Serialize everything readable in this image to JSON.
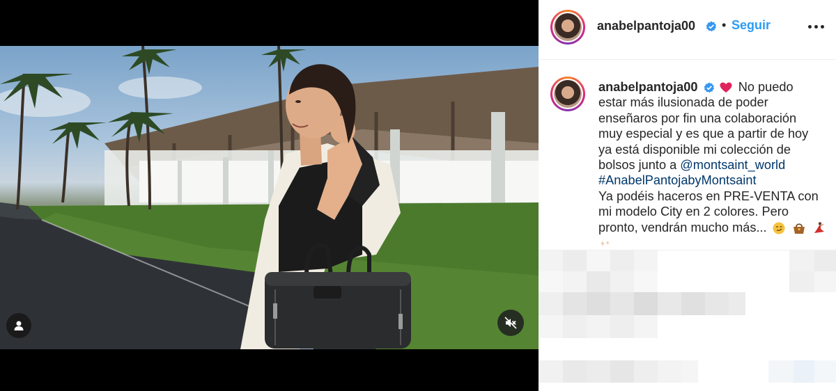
{
  "post": {
    "username": "anabelpantoja00",
    "verified": true,
    "separator": "•",
    "follow_label": "Seguir",
    "more_icon": "more-horizontal-icon"
  },
  "caption": {
    "username": "anabelpantoja00",
    "lines": [
      "No puedo",
      "estar más ilusionada de poder",
      "enseñaros por fin una colaboración",
      "muy especial y es que a partir de hoy",
      "ya está disponible mi colección de",
      "bolsos junto a",
      "Ya podéis haceros en PRE-VENTA con",
      "mi modelo City en 2 colores. Pero",
      "pronto, vendrán mucho más..."
    ],
    "mention": "@montsaint_world",
    "hashtag": "#AnabelPantojabyMontsaint"
  },
  "colors": {
    "link": "#00376b",
    "follow": "#2b9cf6",
    "verified": "#3897f0",
    "text": "#262626"
  },
  "video": {
    "user_tag_icon": "user-tag-icon",
    "mute_icon": "muted-speaker-icon"
  }
}
